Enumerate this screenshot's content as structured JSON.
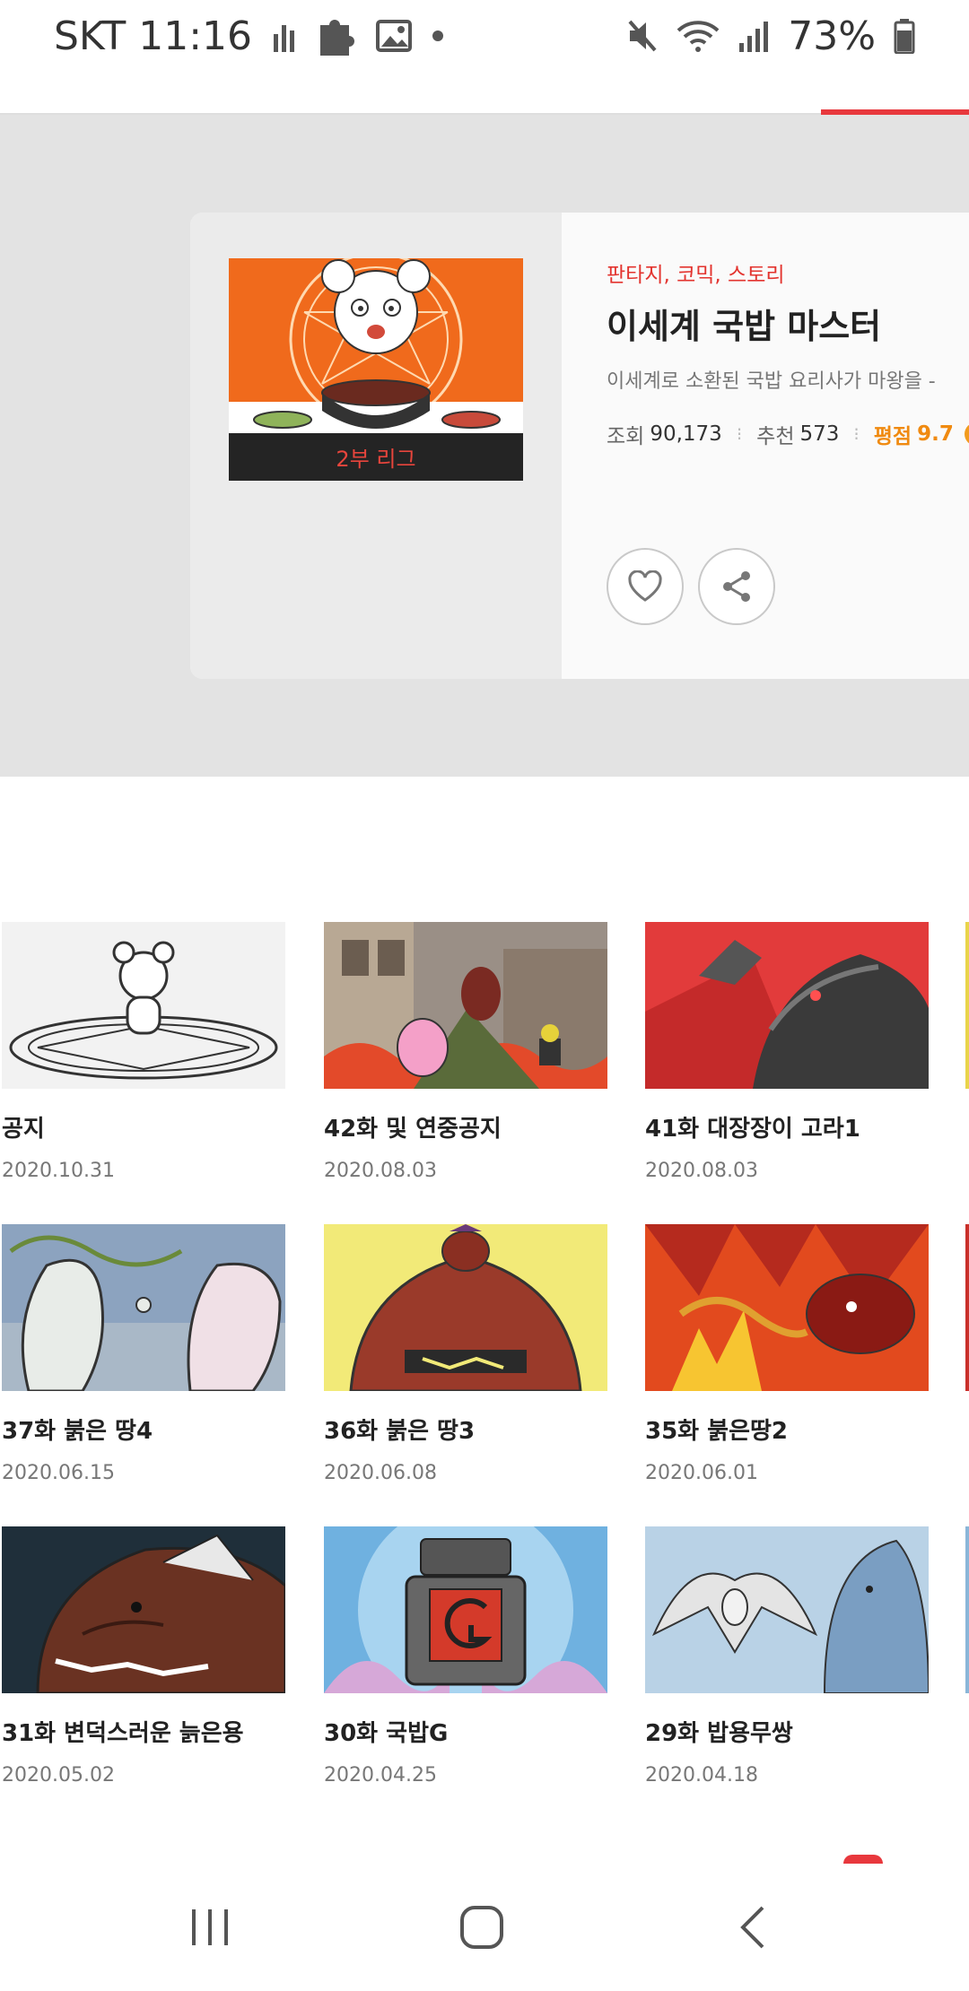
{
  "status_bar": {
    "carrier_time": "SKT 11:16",
    "battery": "73%",
    "left_icons": [
      "signal-bars-icon",
      "puzzle-icon",
      "gallery-icon",
      "dot-icon"
    ],
    "right_icons": [
      "mute-icon",
      "wifi-icon",
      "cell-signal-icon",
      "battery-icon"
    ]
  },
  "header": {
    "active_tab_color": "#e8383d"
  },
  "series": {
    "cover_badge": "2부 리그",
    "genre": "판타지, 코믹, 스토리",
    "title": "이세계 국밥 마스터",
    "description": "이세계로 소환된 국밥 요리사가 마왕을 -",
    "stats": {
      "views_label": "조회",
      "views": "90,173",
      "recommend_label": "추천",
      "recommend": "573",
      "rating_label": "평점",
      "rating": "9.7"
    },
    "actions": {
      "favorite_icon": "heart-icon",
      "share_icon": "share-icon"
    }
  },
  "episodes": [
    {
      "title": "공지",
      "date": "2020.10.31"
    },
    {
      "title": "42화 및 연중공지",
      "date": "2020.08.03"
    },
    {
      "title": "41화 대장장이 고라1",
      "date": "2020.08.03"
    },
    {
      "title": "37화 붉은 땅4",
      "date": "2020.06.15"
    },
    {
      "title": "36화 붉은 땅3",
      "date": "2020.06.08"
    },
    {
      "title": "35화 붉은땅2",
      "date": "2020.06.01"
    },
    {
      "title": "31화 변덕스러운 늙은용",
      "date": "2020.05.02"
    },
    {
      "title": "30화 국밥G",
      "date": "2020.04.25"
    },
    {
      "title": "29화 밥용무쌍",
      "date": "2020.04.18"
    }
  ],
  "navbar": {
    "icons": [
      "recent-apps-icon",
      "home-icon",
      "back-icon"
    ]
  }
}
